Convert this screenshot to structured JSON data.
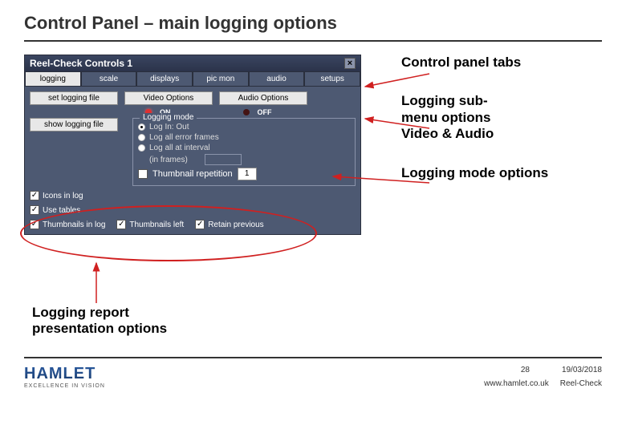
{
  "slide": {
    "title": "Control Panel – main logging options"
  },
  "panel": {
    "window_title": "Reel-Check Controls 1",
    "tabs": [
      "logging",
      "scale",
      "displays",
      "pic mon",
      "audio",
      "setups"
    ],
    "buttons": {
      "set_logging": "set  logging file",
      "video_opts": "Video Options",
      "audio_opts": "Audio Options",
      "show_logging": "show  logging file"
    },
    "onoff": {
      "on": "ON",
      "off": "OFF"
    },
    "logging_mode": {
      "legend": "Logging mode",
      "opt1": "Log In: Out",
      "opt2": "Log all error frames",
      "opt3": "Log all at interval",
      "opt3b": "(in frames)",
      "thumb_rep": "Thumbnail repetition",
      "thumb_rep_val": "1"
    },
    "checks": {
      "icons": "Icons in log",
      "use_tables": "Use tables",
      "thumbs_in_log": "Thumbnails in log",
      "thumbs_left": "Thumbnails left",
      "retain_prev": "Retain previous"
    }
  },
  "annotations": {
    "a1": "Control panel tabs",
    "a2_l1": "Logging sub-",
    "a2_l2": "menu options",
    "a2_l3": "Video & Audio",
    "a3": "Logging mode options",
    "a4_l1": "Logging report",
    "a4_l2": "presentation options"
  },
  "footer": {
    "logo_main": "HAMLET",
    "logo_sub": "EXCELLENCE IN VISION",
    "page": "28",
    "date": "19/03/2018",
    "url": "www.hamlet.co.uk",
    "product": "Reel-Check"
  }
}
